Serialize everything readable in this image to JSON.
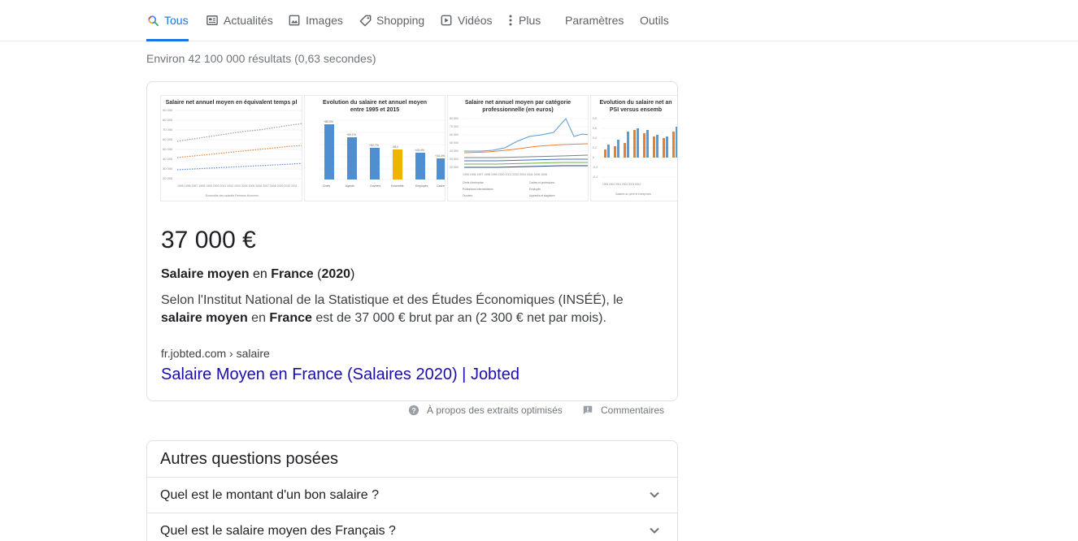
{
  "tabs": [
    {
      "label": "Tous",
      "icon": "search-icon",
      "active": true
    },
    {
      "label": "Actualités",
      "icon": "news-icon"
    },
    {
      "label": "Images",
      "icon": "image-icon"
    },
    {
      "label": "Shopping",
      "icon": "tag-icon"
    },
    {
      "label": "Vidéos",
      "icon": "video-icon"
    },
    {
      "label": "Plus",
      "icon": "more-vert-icon"
    },
    {
      "label": "Paramètres"
    },
    {
      "label": "Outils"
    }
  ],
  "result_stats": "Environ 42 100 000 résultats (0,63 secondes)",
  "snippet": {
    "thumbnails": [
      {
        "title": "Salaire net annuel moyen en équivalent temps pl"
      },
      {
        "title": "Evolution du salaire net annuel moyen",
        "title2": "entre 1995 et 2015"
      },
      {
        "title": "Salaire net annuel moyen par catégorie",
        "title2": "professionnelle (en euros)"
      },
      {
        "title": "Evolution du salaire net an",
        "title2": "PSI versus ensemb"
      }
    ],
    "big_answer": "37 000 €",
    "sub": {
      "part1": "Salaire moyen",
      "part2": " en ",
      "part3": "France",
      "part4": " (",
      "part5": "2020",
      "part6": ")"
    },
    "desc": {
      "line1": "Selon l'Institut National de la Statistique et des Études Économiques (INSÉÉ), le ",
      "bold1": "salaire moyen",
      "mid": " en ",
      "bold2": "France",
      "end": " est de 37 000 € brut par an (2 300 € net par mois)."
    },
    "source_url": "fr.jobted.com › salaire",
    "source_title": "Salaire Moyen en France (Salaires 2020) | Jobted"
  },
  "footer": {
    "about_label": "À propos des extraits optimisés",
    "feedback_label": "Commentaires"
  },
  "paa": {
    "title": "Autres questions posées",
    "questions": [
      "Quel est le montant d'un bon salaire ?",
      "Quel est le salaire moyen des Français ?"
    ]
  },
  "colors": {
    "accent": "#1a73e8",
    "link": "#1a0dab",
    "muted": "#70757a"
  }
}
